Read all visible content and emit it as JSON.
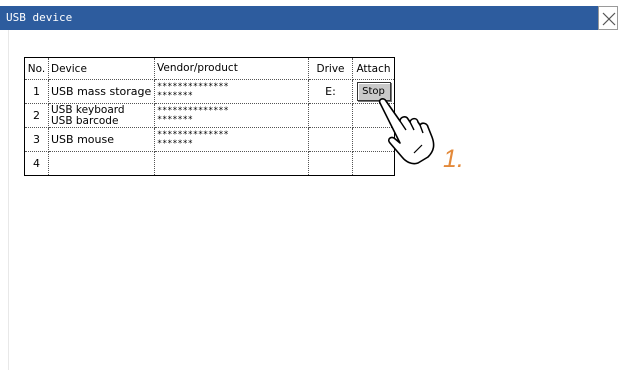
{
  "window": {
    "title": "USB device"
  },
  "table": {
    "headers": {
      "no": "No.",
      "device": "Device",
      "vendor": "Vendor/product",
      "drive": "Drive",
      "attach": "Attach"
    },
    "rows": [
      {
        "no": "1",
        "device_line1": "USB mass storage",
        "device_line2": "",
        "vendor_line1": "**************",
        "vendor_line2": "*******",
        "drive": "E:",
        "attach": "Stop"
      },
      {
        "no": "2",
        "device_line1": "USB keyboard",
        "device_line2": "USB barcode",
        "vendor_line1": "**************",
        "vendor_line2": "*******",
        "drive": "",
        "attach": ""
      },
      {
        "no": "3",
        "device_line1": "USB mouse",
        "device_line2": "",
        "vendor_line1": "**************",
        "vendor_line2": "*******",
        "drive": "",
        "attach": ""
      },
      {
        "no": "4",
        "device_line1": "",
        "device_line2": "",
        "vendor_line1": "",
        "vendor_line2": "",
        "drive": "",
        "attach": ""
      }
    ]
  },
  "annotation": {
    "step_label": "1.",
    "color": "#e3893a"
  },
  "icons": {
    "close": "close-icon",
    "pointer": "pointing-hand-icon"
  },
  "colors": {
    "titlebar": "#2d5c9e",
    "button": "#c9c9c9"
  }
}
